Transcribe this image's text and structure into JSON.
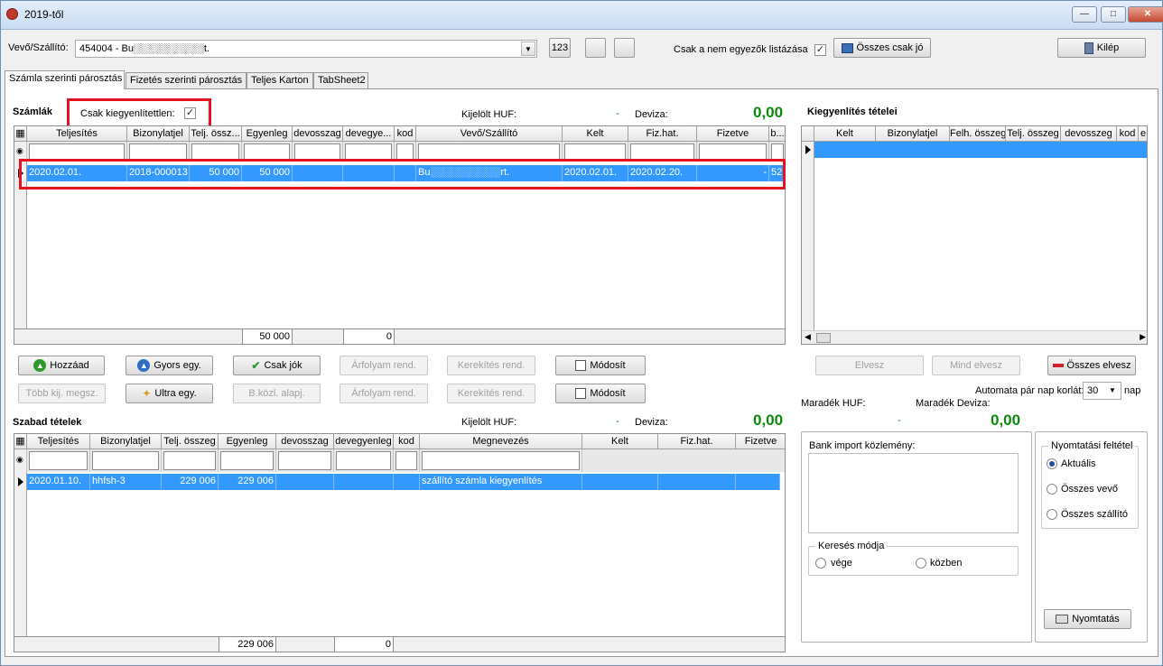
{
  "window": {
    "title": "2019-től"
  },
  "top": {
    "partner_label": "Vevő/Szállító:",
    "partner_value": "454004 - Bu░░░░░░░░░░t.",
    "btn_123": "123",
    "only_mismatch_label": "Csak a nem egyezők listázása",
    "all_ok_button": "Összes csak jó",
    "exit_button": "Kilép"
  },
  "tabs": [
    "Számla szerinti párosztás",
    "Fizetés szerinti párosztás",
    "Teljes Karton",
    "TabSheet2"
  ],
  "invoices": {
    "title": "Számlák",
    "unsettled_label": "Csak kiegyenlítettlen:",
    "selected_huf_label": "Kijelölt HUF:",
    "selected_huf_value": "-",
    "currency_label": "Deviza:",
    "currency_value": "0,00",
    "columns": [
      "Teljesítés",
      "Bizonylatjel",
      "Telj. össz...",
      "Egyenleg",
      "devosszag",
      "devegye...",
      "kod",
      "Vevő/Szállító",
      "Kelt",
      "Fiz.hat.",
      "Fizetve",
      "b..."
    ],
    "row": [
      "2020.02.01.",
      "2018-000013",
      "50 000",
      "50 000",
      "",
      "",
      "",
      "Bu░░░░░░░░░░rt.",
      "2020.02.01.",
      "2020.02.20.",
      "-",
      "52"
    ],
    "footer": {
      "balance_total": "50 000",
      "currency_total": "0"
    }
  },
  "buttons1": {
    "add": "Hozzáad",
    "quick": "Gyors egy.",
    "only_ok": "Csak jók",
    "rate": "Árfolyam rend.",
    "round": "Kerekítés rend.",
    "modify": "Módosít",
    "multi": "Több kij. megsz.",
    "ultra": "Ultra egy.",
    "bank": "B.közl. alapj.",
    "rate2": "Árfolyam rend.",
    "round2": "Kerekítés rend.",
    "modify2": "Módosít"
  },
  "settle": {
    "title": "Kiegyenlítés tételei",
    "columns": [
      "Kelt",
      "Bizonylatjel",
      "Felh. összeg",
      "Telj. összeg",
      "devosszeg",
      "kod",
      "e"
    ],
    "drop": "Elvesz",
    "drop_all": "Mind elvesz",
    "drop_every": "Összes elvesz",
    "auto_label": "Automata pár nap korlát:",
    "auto_value": "30",
    "auto_unit": "nap",
    "rem_huf_label": "Maradék HUF:",
    "rem_dev_label": "Maradék Deviza:",
    "rem_huf_value": "-",
    "rem_dev_value": "0,00"
  },
  "free": {
    "title": "Szabad tételek",
    "selected_huf_label": "Kijelölt HUF:",
    "selected_huf_value": "-",
    "currency_label": "Deviza:",
    "currency_value": "0,00",
    "columns": [
      "Teljesítés",
      "Bizonylatjel",
      "Telj. összeg",
      "Egyenleg",
      "devosszag",
      "devegyenleg",
      "kod",
      "Megnevezés",
      "Kelt",
      "Fiz.hat.",
      "Fizetve"
    ],
    "row": [
      "2020.01.10.",
      "hhfsh-3",
      "229 006",
      "229 006",
      "",
      "",
      "",
      "szállító számla kiegyenlítés",
      "",
      "",
      ""
    ],
    "footer": {
      "balance_total": "229 006",
      "currency_total": "0"
    }
  },
  "bank": {
    "title": "Bank import közlemény:",
    "search_title": "Keresés módja",
    "opt_end": "vége",
    "opt_mid": "közben"
  },
  "print": {
    "title": "Nyomtatási feltétel",
    "opt_current": "Aktuális",
    "opt_all_customer": "Összes vevő",
    "opt_all_supplier": "Összes szállító",
    "button": "Nyomtatás"
  }
}
